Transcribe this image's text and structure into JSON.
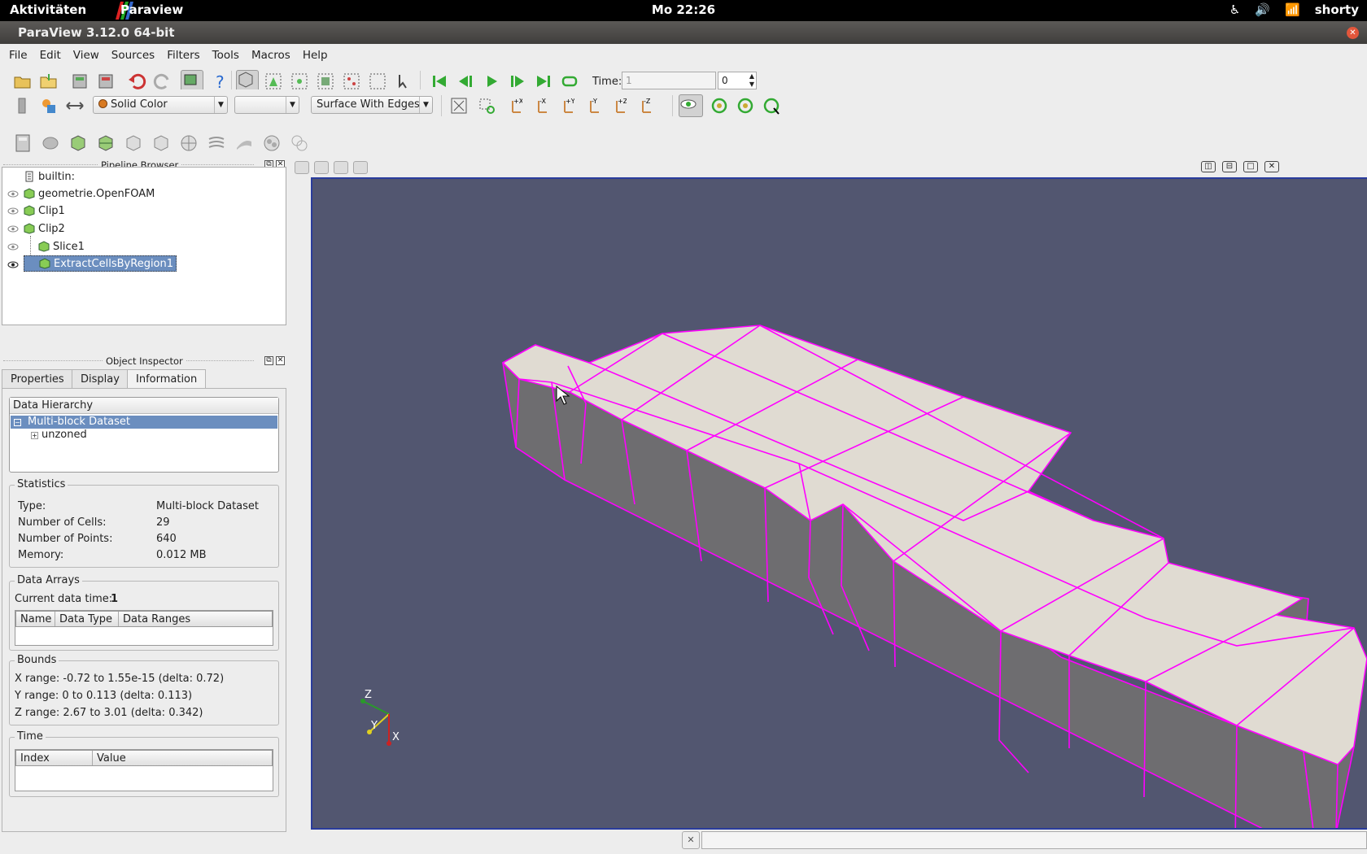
{
  "topbar": {
    "activities": "Aktivitäten",
    "app": "Paraview",
    "clock": "Mo 22:26",
    "user": "shorty"
  },
  "window": {
    "title": "ParaView 3.12.0 64-bit"
  },
  "menu": [
    "File",
    "Edit",
    "View",
    "Sources",
    "Filters",
    "Tools",
    "Macros",
    "Help"
  ],
  "time": {
    "label": "Time:",
    "value": "1",
    "index": "0"
  },
  "color_combo": "Solid Color",
  "component_combo": "",
  "repr_combo": "Surface With Edges",
  "pipeline": {
    "title": "Pipeline Browser",
    "items": [
      "builtin:",
      "geometrie.OpenFOAM",
      "Clip1",
      "Clip2",
      "Slice1",
      "ExtractCellsByRegion1"
    ]
  },
  "inspector": {
    "title": "Object Inspector",
    "tabs": [
      "Properties",
      "Display",
      "Information"
    ],
    "hier_title": "Data Hierarchy",
    "hier_items": [
      "Multi-block Dataset",
      "unzoned"
    ],
    "stats_title": "Statistics",
    "stats": [
      {
        "k": "Type:",
        "v": "Multi-block Dataset"
      },
      {
        "k": "Number of Cells:",
        "v": "29"
      },
      {
        "k": "Number of Points:",
        "v": "640"
      },
      {
        "k": "Memory:",
        "v": "0.012 MB"
      }
    ],
    "arrays_title": "Data Arrays",
    "current_time_label": "Current data time:",
    "current_time": "1",
    "arrays_cols": [
      "Name",
      "Data Type",
      "Data Ranges"
    ],
    "bounds_title": "Bounds",
    "bounds": [
      "X range: -0.72 to 1.55e-15 (delta: 0.72)",
      "Y range: 0 to 0.113 (delta: 0.113)",
      "Z range: 2.67 to 3.01 (delta: 0.342)"
    ],
    "time_title": "Time",
    "time_cols": [
      "Index",
      "Value"
    ]
  },
  "axes": {
    "z": "Z",
    "y": "Y",
    "x": "X"
  },
  "colors": {
    "background": "#525670",
    "edges": "#ff00ff",
    "top_face": "#e0dbd2",
    "side_face": "#6e6d70",
    "selection": "#6b8ebf"
  }
}
